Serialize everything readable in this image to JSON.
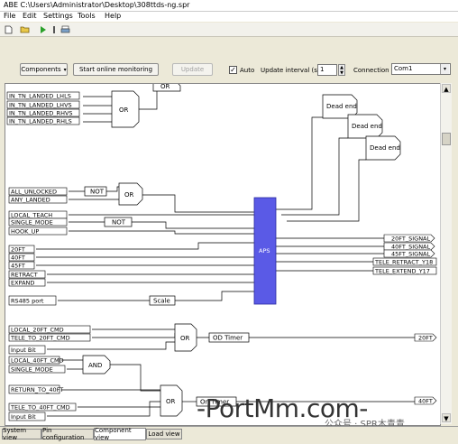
{
  "window": {
    "title": "ABE C:\\Users\\Administrator\\Desktop\\308ttds-ng.spr"
  },
  "menu": [
    "File",
    "Edit",
    "Settings",
    "Tools",
    "Help"
  ],
  "toolbar_icons": [
    "new-file-icon",
    "open-folder-icon",
    "run-icon",
    "stop-icon",
    "print-icon"
  ],
  "controls": {
    "components_label": "Components",
    "monitor_label": "Start online monitoring",
    "update_label": "Update",
    "auto_label": "Auto",
    "auto_checked": true,
    "interval_label": "Update interval (s) :",
    "interval_value": "1",
    "connection_label": "Connection :",
    "connection_value": "Com1"
  },
  "diagram": {
    "inputs_top": [
      "IN_TN_LANDED_LHLS",
      "IN_TN_LANDED_LHVS",
      "IN_TN_LANDED_RHVS",
      "IN_TN_LANDED_RHLS"
    ],
    "inputs_mid": [
      "ALL_UNLOCKED",
      "ANY_LANDED",
      "LOCAL_TEACH",
      "SINGLE_MODE",
      "HOOK_UP",
      "20FT",
      "40FT",
      "45FT",
      "RETRACT",
      "EXPAND",
      "RS485 port"
    ],
    "inputs_bottom": [
      "LOCAL_20FT_CMD",
      "TELE_TO_20FT_CMD",
      "Input Bit",
      "LOCAL_40FT_CMD",
      "SINGLE_MODE",
      "RETURN_TO_40FT",
      "TELE_TO_40FT_CMD",
      "Input Bit"
    ],
    "blocks": {
      "or": "OR",
      "not": "NOT",
      "and": "AND",
      "scale": "Scale",
      "aps": "APS",
      "dead_end": "Dead end",
      "od_timer": "OD Timer",
      "on_timer": "On Timer"
    },
    "outputs": [
      "20FT_SIGNAL",
      "40FT_SIGNAL",
      "45FT_SIGNAL",
      "TELE_RETRACT_Y18",
      "TELE_EXTEND_Y17",
      "20FT",
      "40FT"
    ]
  },
  "tabs": [
    "System view",
    "Pin configuration",
    "Component view",
    "Load view"
  ],
  "active_tab": "Component view",
  "watermark": {
    "main": "-PortMm.com-",
    "sub": "公众号 · SPR木青青"
  },
  "colors": {
    "aps_fill": "#5a5ae6",
    "aps_stroke": "#2a2aa0",
    "canvas_bg": "#ffffff"
  }
}
